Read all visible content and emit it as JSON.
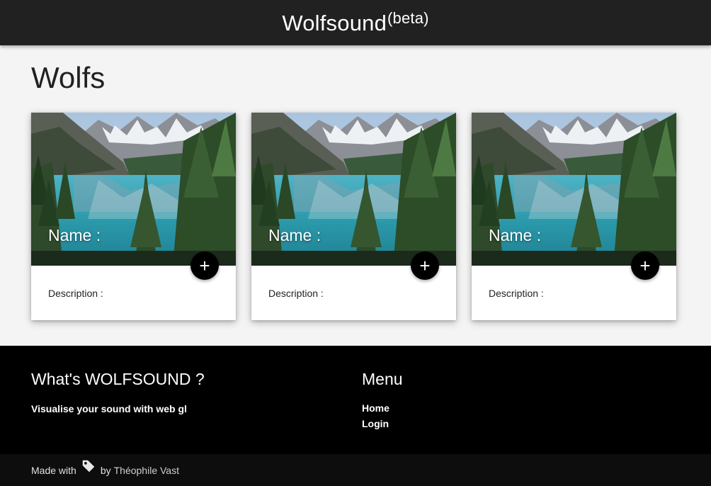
{
  "header": {
    "brand": "Wolfsound",
    "brand_suffix": "(beta)"
  },
  "main": {
    "title": "Wolfs",
    "cards": [
      {
        "name_label": "Name :",
        "description_label": "Description :",
        "action_icon": "plus-icon",
        "image": "mountain-lake-photo"
      },
      {
        "name_label": "Name :",
        "description_label": "Description :",
        "action_icon": "plus-icon",
        "image": "mountain-lake-photo"
      },
      {
        "name_label": "Name :",
        "description_label": "Description :",
        "action_icon": "plus-icon",
        "image": "mountain-lake-photo"
      }
    ],
    "add_symbol": "+"
  },
  "footer": {
    "about_title": "What's WOLFSOUND ?",
    "about_text": "Visualise your sound with web gl",
    "menu_title": "Menu",
    "menu_items": [
      {
        "label": "Home"
      },
      {
        "label": "Login"
      }
    ],
    "copyright_prefix": "Made with",
    "copyright_icon": "tag-icon",
    "copyright_by": "by",
    "author": "Théophile Vast"
  },
  "colors": {
    "topbar": "#212121",
    "page_background": "#f4f4f4",
    "footer": "#000000",
    "fab": "#000000"
  }
}
